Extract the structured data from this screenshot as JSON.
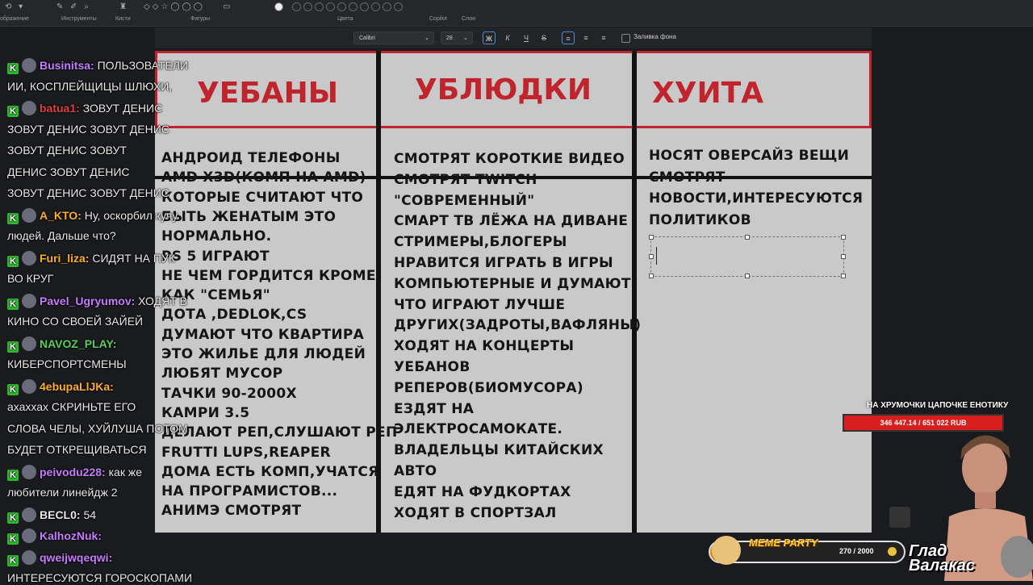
{
  "ribbon": {
    "groups": [
      "ображение",
      "Инструменты",
      "Кисти",
      "Фигуры",
      "Цвета",
      "Copilot",
      "Слои"
    ]
  },
  "toolbar": {
    "font": "Calibri",
    "size": "28",
    "bold": "Ж",
    "italic": "К",
    "underline": "Ч",
    "strike": "S",
    "fill_label": "Заливка фона"
  },
  "table": {
    "columns": [
      {
        "header": "УЕБАНЫ",
        "lines": [
          "АНДРОИД ТЕЛЕФОНЫ",
          "AMD X3D(КОМП НА AMD)",
          "КОТОРЫЕ СЧИТАЮТ ЧТО",
          "БЫТЬ ЖЕНАТЫМ ЭТО",
          "НОРМАЛЬНО.",
          "PS 5 ИГРАЮТ",
          "НЕ ЧЕМ ГОРДИТСЯ КРОМЕ",
          "КАК \"СЕМЬЯ\"",
          "ДОТА ,DEDLOK,CS",
          "ДУМАЮТ ЧТО КВАРТИРА",
          "ЭТО ЖИЛЬЕ ДЛЯ ЛЮДЕЙ",
          "ЛЮБЯТ МУСОР",
          "ТАЧКИ 90-2000Х",
          "КАМРИ 3.5",
          "ДЕЛАЮТ РЕП,СЛУШАЮТ РЕП",
          "FRUTTI LUPS,REAPER",
          "ДОМА ЕСТЬ КОМП,УЧАТСЯ",
          "НА ПРОГРАМИСТОВ...",
          "АНИМЭ СМОТРЯТ"
        ]
      },
      {
        "header": "УБЛЮДКИ",
        "lines": [
          "СМОТРЯТ КОРОТКИЕ ВИДЕО",
          "СМОТРЯТ TWITCH",
          "\"СОВРЕМЕННЫЙ\"",
          "СМАРТ ТВ ЛЁЖА НА ДИВАНЕ",
          "СТРИМЕРЫ,БЛОГЕРЫ",
          "НРАВИТСЯ ИГРАТЬ В ИГРЫ",
          "КОМПЬЮТЕРНЫЕ И ДУМАЮТ",
          "ЧТО ИГРАЮТ ЛУЧШЕ",
          "ДРУГИХ(ЗАДРОТЫ,ВАФЛЯНЫ)",
          "ХОДЯТ НА КОНЦЕРТЫ",
          "УЕБАНОВ",
          "РЕПЕРОВ(БИОМУСОРА)",
          "ЕЗДЯТ НА",
          "ЭЛЕКТРОСАМОКАТЕ.",
          "ВЛАДЕЛЬЦЫ КИТАЙСКИХ",
          "АВТО",
          "ЕДЯТ НА ФУДКОРТАХ",
          "ХОДЯТ В СПОРТЗАЛ"
        ]
      },
      {
        "header": "ХУИТА",
        "lines": [
          "НОСЯТ ОВЕРСАЙЗ ВЕЩИ",
          "СМОТРЯТ",
          "НОВОСТИ,ИНТЕРЕСУЮТСЯ",
          "ПОЛИТИКОВ"
        ]
      }
    ]
  },
  "chat": [
    {
      "lines": [
        [
          "Businitsa: ",
          "ПОЛЬЗОВАТЕЛИ"
        ],
        [
          "",
          "ИИ, КОСПЛЕЙЩИЦЫ ШЛЮХИ,"
        ]
      ],
      "color": "#c87cff"
    },
    {
      "lines": [
        [
          "batua1: ",
          "ЗОВУТ ДЕНИС"
        ],
        [
          "",
          "ЗОВУТ ДЕНИС   ЗОВУТ ДЕНИС"
        ],
        [
          "",
          "   ЗОВУТ ДЕНИС    ЗОВУТ"
        ],
        [
          "",
          "ДЕНИС    ЗОВУТ ДЕНИС"
        ],
        [
          "",
          "ЗОВУТ ДЕНИС    ЗОВУТ ДЕНИС"
        ]
      ],
      "color": "#e04040"
    },
    {
      "lines": [
        [
          "A_KTO: ",
          "Ну, оскорбил кучу"
        ],
        [
          "",
          "людей. Дальше что?"
        ]
      ],
      "color": "#ffb020"
    },
    {
      "lines": [
        [
          "Furi_liza: ",
          "СИДЯТ НА ПУК"
        ],
        [
          "",
          "ВО КРУГ"
        ]
      ],
      "color": "#ffb020"
    },
    {
      "lines": [
        [
          "Pavel_Ugryumov: ",
          "ХОДЯТ В"
        ],
        [
          "",
          "КИНО СО СВОЕЙ ЗАЙЕЙ"
        ]
      ],
      "color": "#c87cff"
    },
    {
      "lines": [
        [
          "NAVOZ_PLAY: ",
          ""
        ],
        [
          "",
          "КИБЕРСПОРТСМЕНЫ"
        ]
      ],
      "color": "#5ad05a"
    },
    {
      "lines": [
        [
          "4ebupaLlJKa: ",
          ""
        ],
        [
          "",
          "ахаххах СКРИНЬТЕ ЕГО"
        ],
        [
          "",
          "СЛОВА ЧЕЛЫ, ХУЙЛУША ПОТОМ"
        ],
        [
          "",
          "БУДЕТ ОТКРЕЩИВАТЬСЯ"
        ]
      ],
      "color": "#ffb020"
    },
    {
      "lines": [
        [
          "peivodu228: ",
          "как же"
        ],
        [
          "",
          "любители линейдж 2"
        ]
      ],
      "color": "#c87cff"
    },
    {
      "lines": [
        [
          "BECL0: ",
          "54"
        ]
      ],
      "color": "#e8e8e8"
    },
    {
      "lines": [
        [
          "KalhozNuk: ",
          ""
        ]
      ],
      "color": "#c87cff"
    },
    {
      "lines": [
        [
          "qweijwqeqwi: ",
          ""
        ],
        [
          "",
          "ИНТЕРЕСУЮТСЯ ГОРОСКОПАМИ"
        ]
      ],
      "color": "#c87cff"
    }
  ],
  "overlay": {
    "goal_label": "НА ХРУМОЧКИ ЦАПОЧКЕ ЕНОТИКУ",
    "goal_value": "346 447.14 / 651 022 RUB",
    "goal_fraction": 0.53,
    "meme_label": "MEME PARTY",
    "meme_count": "270 / 2000",
    "meme_fraction": 0.135,
    "brand_line1": "Глад",
    "brand_line2": "Валакас"
  }
}
